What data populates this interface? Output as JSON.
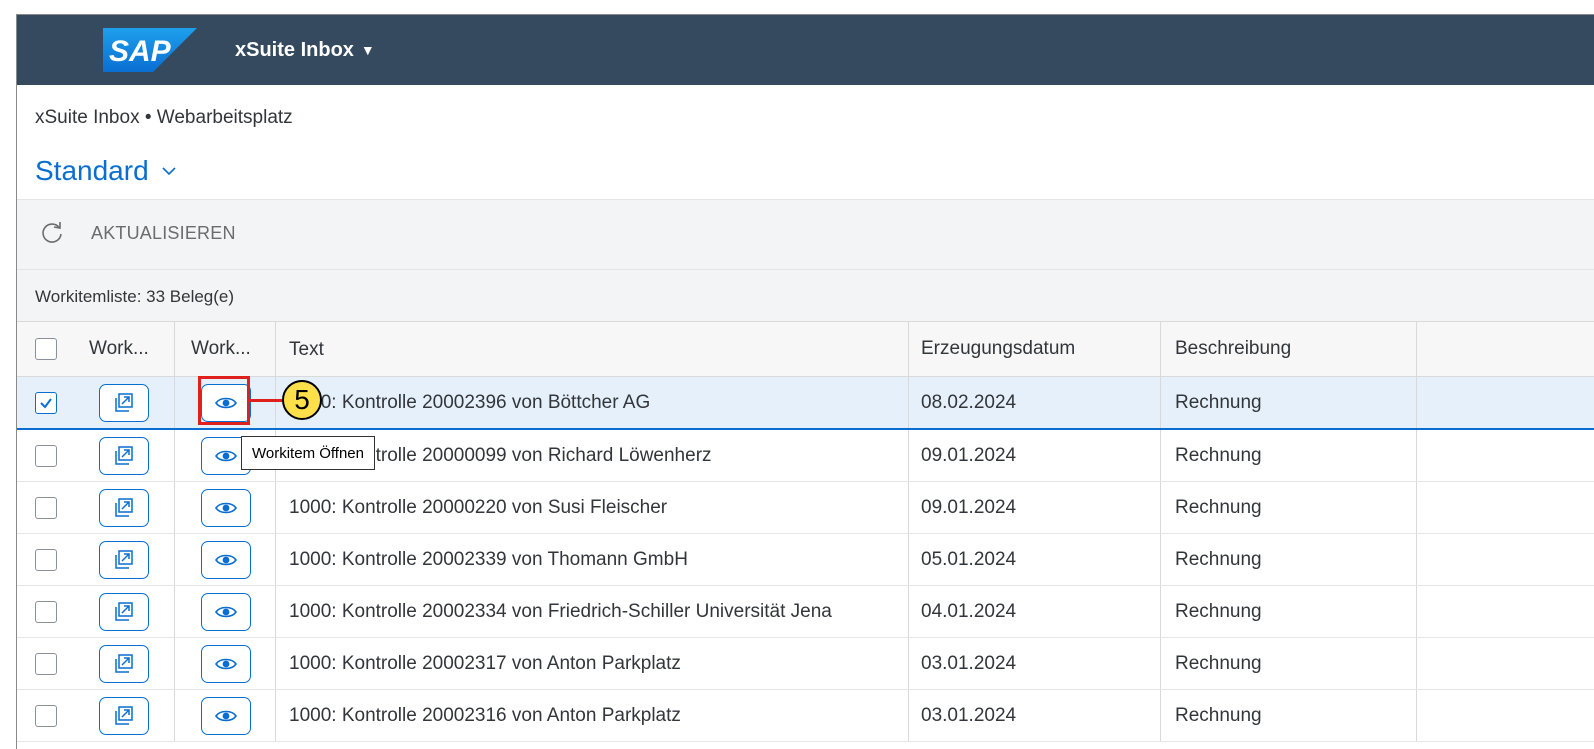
{
  "shell": {
    "logo_text": "SAP",
    "app_title": "xSuite Inbox",
    "background": "#354a5f"
  },
  "breadcrumb": "xSuite Inbox • Webarbeitsplatz",
  "variant": {
    "label": "Standard",
    "icon": "chevron-down-icon"
  },
  "toolbar": {
    "refresh_label": "AKTUALISIEREN",
    "refresh_icon": "refresh-icon"
  },
  "list": {
    "title": "Workitemliste: 33 Beleg(e)",
    "columns": [
      "Work...",
      "Work...",
      "Text",
      "Erzeugungsdatum",
      "Beschreibung"
    ],
    "rows": [
      {
        "text": "1000: Kontrolle 20002396 von Böttcher AG",
        "date": "08.02.2024",
        "desc": "Rechnung",
        "selected": true
      },
      {
        "text": "1000: Kontrolle 20000099 von Richard Löwenherz",
        "date": "09.01.2024",
        "desc": "Rechnung",
        "selected": false
      },
      {
        "text": "1000: Kontrolle 20000220 von Susi Fleischer",
        "date": "09.01.2024",
        "desc": "Rechnung",
        "selected": false
      },
      {
        "text": "1000: Kontrolle 20002339 von Thomann GmbH",
        "date": "05.01.2024",
        "desc": "Rechnung",
        "selected": false
      },
      {
        "text": "1000: Kontrolle 20002334 von Friedrich-Schiller Universität Jena",
        "date": "04.01.2024",
        "desc": "Rechnung",
        "selected": false
      },
      {
        "text": "1000: Kontrolle 20002317 von Anton Parkplatz",
        "date": "03.01.2024",
        "desc": "Rechnung",
        "selected": false
      },
      {
        "text": "1000: Kontrolle 20002316 von Anton Parkplatz",
        "date": "03.01.2024",
        "desc": "Rechnung",
        "selected": false
      }
    ]
  },
  "tooltip": "Workitem Öffnen",
  "callout": {
    "number": "5",
    "color": "#ffe04a",
    "highlight_color": "#e0201a"
  },
  "accent": "#0a6ed1"
}
